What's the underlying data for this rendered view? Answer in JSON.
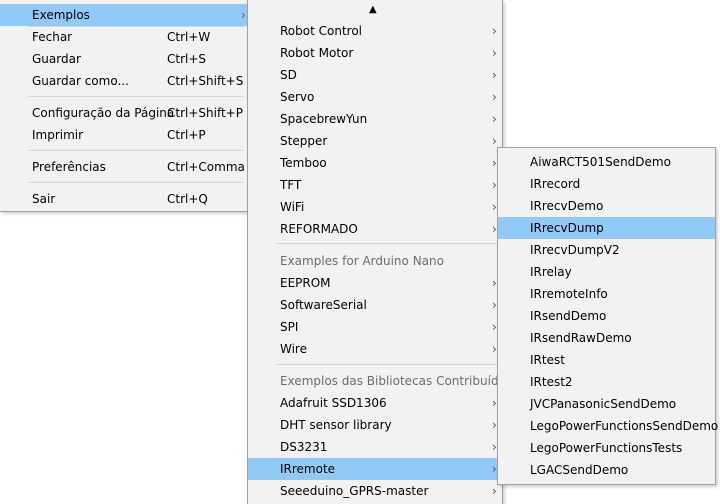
{
  "menu_file": {
    "items": [
      {
        "label": "Exemplos",
        "shortcut": ""
      },
      {
        "label": "Fechar",
        "shortcut": "Ctrl+W"
      },
      {
        "label": "Guardar",
        "shortcut": "Ctrl+S"
      },
      {
        "label": "Guardar como...",
        "shortcut": "Ctrl+Shift+S"
      },
      {
        "label": "Configuração da Página",
        "shortcut": "Ctrl+Shift+P"
      },
      {
        "label": "Imprimir",
        "shortcut": "Ctrl+P"
      },
      {
        "label": "Preferências",
        "shortcut": "Ctrl+Comma"
      },
      {
        "label": "Sair",
        "shortcut": "Ctrl+Q"
      }
    ]
  },
  "menu_examples": {
    "scroll_up_glyph": "▲",
    "items": [
      "Robot Control",
      "Robot Motor",
      "SD",
      "Servo",
      "SpacebrewYun",
      "Stepper",
      "Temboo",
      "TFT",
      "WiFi",
      "REFORMADO"
    ],
    "section_nano": "Examples for Arduino Nano",
    "nano_items": [
      "EEPROM",
      "SoftwareSerial",
      "SPI",
      "Wire"
    ],
    "section_contrib": "Exemplos das Bibliotecas Contribuídas",
    "contrib_items": [
      "Adafruit SSD1306",
      "DHT sensor library",
      "DS3231",
      "IRremote",
      "Seeeduino_GPRS-master"
    ]
  },
  "menu_irremote": {
    "items": [
      "AiwaRCT501SendDemo",
      "IRrecord",
      "IRrecvDemo",
      "IRrecvDump",
      "IRrecvDumpV2",
      "IRrelay",
      "IRremoteInfo",
      "IRsendDemo",
      "IRsendRawDemo",
      "IRtest",
      "IRtest2",
      "JVCPanasonicSendDemo",
      "LegoPowerFunctionsSendDemo",
      "LegoPowerFunctionsTests",
      "LGACSendDemo"
    ]
  },
  "colors": {
    "highlight": "#91c9f7",
    "menu_bg": "#f2f2f2",
    "disabled_text": "#6d6d6d"
  }
}
